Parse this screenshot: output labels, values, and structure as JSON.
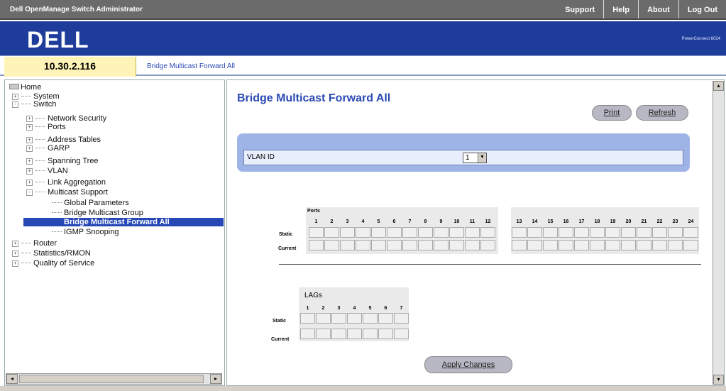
{
  "header": {
    "app_title": "Dell OpenManage Switch Administrator",
    "links": [
      "Support",
      "Help",
      "About",
      "Log Out"
    ],
    "logo": "DELL",
    "product": "PowerConnect 6024"
  },
  "infobar": {
    "ip": "10.30.2.116",
    "breadcrumb": "Bridge Multicast Forward All"
  },
  "sidebar": {
    "root": "Home",
    "items": [
      {
        "label": "System",
        "expander": "+"
      },
      {
        "label": "Switch",
        "expander": "-"
      },
      {
        "label": "Network Security",
        "expander": "+"
      },
      {
        "label": "Ports",
        "expander": "+"
      },
      {
        "label": "Address Tables",
        "expander": "+"
      },
      {
        "label": "GARP",
        "expander": "+"
      },
      {
        "label": "Spanning Tree",
        "expander": "+"
      },
      {
        "label": "VLAN",
        "expander": "+"
      },
      {
        "label": "Link Aggregation",
        "expander": "+"
      },
      {
        "label": "Multicast Support",
        "expander": "-"
      },
      {
        "label": "Global Parameters",
        "expander": ""
      },
      {
        "label": "Bridge Multicast Group",
        "expander": ""
      },
      {
        "label": "Bridge Multicast Forward All",
        "expander": ""
      },
      {
        "label": "IGMP Snooping",
        "expander": ""
      },
      {
        "label": "Router",
        "expander": "+"
      },
      {
        "label": "Statistics/RMON",
        "expander": "+"
      },
      {
        "label": "Quality of Service",
        "expander": "+"
      }
    ],
    "scroll_left": "◂",
    "scroll_right": "▸"
  },
  "main": {
    "title": "Bridge Multicast Forward All",
    "print_label": "Print",
    "refresh_label": "Refresh",
    "vlan_label": "VLAN ID",
    "vlan_value": "1",
    "ports_label": "Ports",
    "ports_a": [
      "1",
      "2",
      "3",
      "4",
      "5",
      "6",
      "7",
      "8",
      "9",
      "10",
      "11",
      "12"
    ],
    "ports_b": [
      "13",
      "14",
      "15",
      "16",
      "17",
      "18",
      "19",
      "20",
      "21",
      "22",
      "23",
      "24"
    ],
    "static_label": "Static",
    "current_label": "Current",
    "lags_label": "LAGs",
    "lags": [
      "1",
      "2",
      "3",
      "4",
      "5",
      "6",
      "7"
    ],
    "apply_label": "Apply Changes",
    "scroll_up": "▴",
    "scroll_down": "▾"
  },
  "colors": {
    "brand_blue": "#1e3c9a",
    "panel_blue": "#9fb4e6",
    "ip_yellow": "#fff4b8",
    "selection": "#2647b5"
  }
}
